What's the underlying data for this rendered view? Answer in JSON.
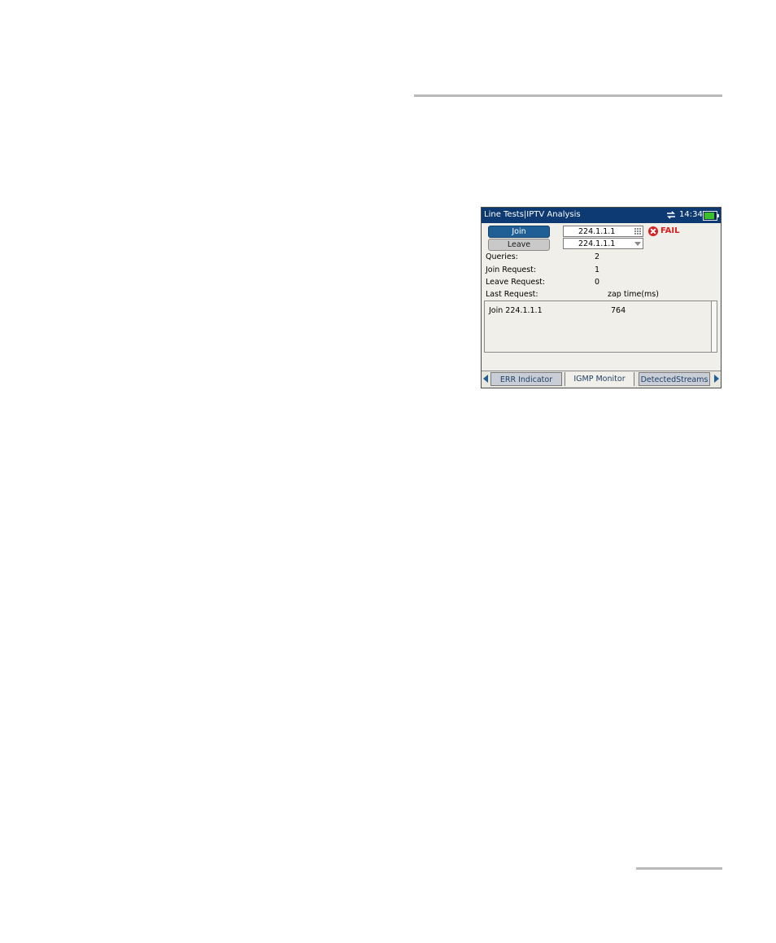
{
  "window": {
    "title": "Line Tests|IPTV Analysis",
    "time": "14:34"
  },
  "controls": {
    "join_label": "Join",
    "leave_label": "Leave",
    "join_ip": "224.1.1.1",
    "leave_ip": "224.1.1.1"
  },
  "status": {
    "text": "FAIL",
    "color": "#d62020"
  },
  "stats": {
    "queries_label": "Queries:",
    "queries_value": "2",
    "join_request_label": "Join Request:",
    "join_request_value": "1",
    "leave_request_label": "Leave Request:",
    "leave_request_value": "0",
    "last_request_label": "Last Request:",
    "zap_time_label": "zap time(ms)"
  },
  "list": {
    "items": [
      {
        "request": "Join 224.1.1.1",
        "zap": "764"
      }
    ]
  },
  "tabs": [
    {
      "label": "ERR Indicator"
    },
    {
      "label": "IGMP Monitor",
      "active": true
    },
    {
      "label": "DetectedStreams"
    }
  ],
  "icons": [
    "sync-icon",
    "battery-icon",
    "keypad-icon",
    "dropdown-icon",
    "fail-icon",
    "scroll-left-icon",
    "scroll-right-icon"
  ],
  "colors": {
    "titlebar": "#0e3a73",
    "accent": "#1f5f96"
  }
}
